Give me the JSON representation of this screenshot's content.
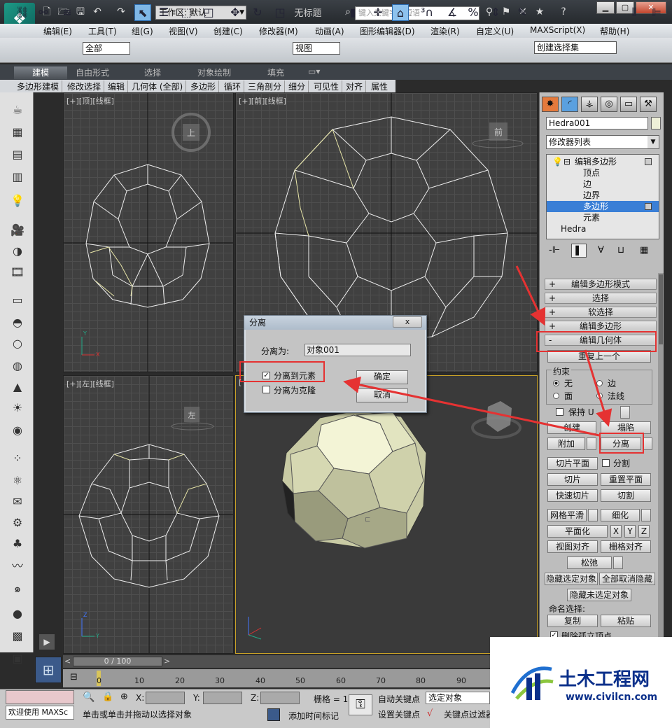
{
  "titlebar": {
    "workspace": "工作区: 默认",
    "doc_title": "无标题",
    "search_placeholder": "键入关键字或短语"
  },
  "menubar": [
    "编辑(E)",
    "工具(T)",
    "组(G)",
    "视图(V)",
    "创建(C)",
    "修改器(M)",
    "动画(A)",
    "图形编辑器(D)",
    "渲染(R)",
    "自定义(U)",
    "MAXScript(X)",
    "帮助(H)"
  ],
  "toolbar": {
    "selection_filter": "全部",
    "ref_coord": "视图",
    "named_selection": "创建选择集"
  },
  "ribbon": {
    "tabs": [
      "建模",
      "自由形式",
      "选择",
      "对象绘制",
      "填充"
    ],
    "sub_items": [
      "多边形建模",
      "修改选择",
      "编辑",
      "几何体 (全部)",
      "多边形",
      "循环",
      "三角剖分",
      "细分",
      "可见性",
      "对齐",
      "属性"
    ]
  },
  "viewports": {
    "top": "[+][顶][线框]",
    "front": "[+][前][线框]",
    "left": "[+][左][线框]",
    "persp": "[",
    "cube_top": "上",
    "cube_front": "前",
    "cube_left": "左"
  },
  "command_panel": {
    "object_name": "Hedra001",
    "object_color": "#eef0d8",
    "modifier_list": "修改器列表",
    "stack": [
      {
        "label": "编辑多边形",
        "level": 0
      },
      {
        "label": "顶点",
        "level": 1
      },
      {
        "label": "边",
        "level": 1
      },
      {
        "label": "边界",
        "level": 1
      },
      {
        "label": "多边形",
        "level": 1,
        "selected": true
      },
      {
        "label": "元素",
        "level": 1
      },
      {
        "label": "Hedra",
        "level": -1
      }
    ],
    "rollouts": [
      {
        "sign": "+",
        "label": "编辑多边形模式"
      },
      {
        "sign": "+",
        "label": "选择"
      },
      {
        "sign": "+",
        "label": "软选择"
      },
      {
        "sign": "+",
        "label": "编辑多边形"
      },
      {
        "sign": "-",
        "label": "编辑几何体"
      }
    ],
    "repeat_last": "重复上一个",
    "constraints_label": "约束",
    "constraint_none": "无",
    "constraint_edge": "边",
    "constraint_face": "面",
    "constraint_normal": "法线",
    "preserve_uv": "保持 U",
    "create": "创建",
    "collapse": "塌陷",
    "attach": "附加",
    "detach": "分离",
    "slice_plane": "切片平面",
    "split": "分割",
    "slice": "切片",
    "reset_plane": "重置平面",
    "quick_slice": "快速切片",
    "cut": "切割",
    "meshsmooth": "网格平滑",
    "tessellate": "细化",
    "planarize": "平面化",
    "x": "X",
    "y": "Y",
    "z": "Z",
    "view_align": "视图对齐",
    "grid_align": "栅格对齐",
    "relax": "松弛",
    "hide_selected": "隐藏选定对象",
    "unhide_all": "全部取消隐藏",
    "hide_unselected": "隐藏未选定对象",
    "named_selections": "命名选择:",
    "copy": "复制",
    "paste": "粘贴",
    "delete_isolated": "删除孤立顶点"
  },
  "dialog": {
    "title": "分离",
    "detach_as_label": "分离为:",
    "detach_as_value": "对象001",
    "to_element": "分离到元素",
    "to_element_checked": true,
    "as_clone": "分离为克隆",
    "as_clone_checked": false,
    "ok": "确定",
    "cancel": "取消",
    "close": "x"
  },
  "timeline": {
    "slider": "0 / 100",
    "ticks": [
      "0",
      "10",
      "20",
      "30",
      "40",
      "50",
      "60",
      "70",
      "80",
      "90"
    ]
  },
  "status": {
    "maxscript": "欢迎使用 MAXSc",
    "prompt": "单击或单击并拖动以选择对象",
    "x_label": "X:",
    "y_label": "Y:",
    "z_label": "Z:",
    "grid": "栅格 = 1",
    "auto_key": "自动关键点",
    "set_key": "设置关键点",
    "selected": "选定对象",
    "add_time_tag": "添加时间标记",
    "key_filters": "关键点过滤器"
  },
  "watermark": {
    "title": "土木工程网",
    "url": "www.civilcn.com"
  }
}
